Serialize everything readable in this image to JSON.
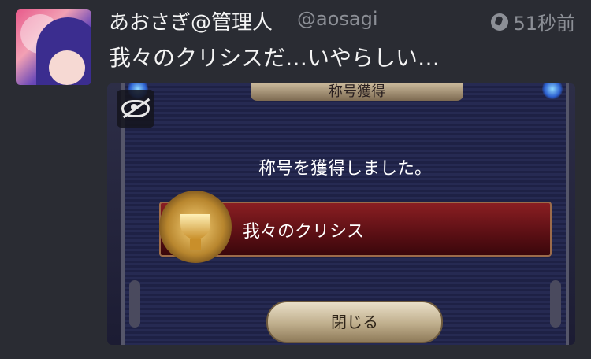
{
  "tweet": {
    "author_name": "あおさぎ@管理人",
    "handle": "@aosagi",
    "time": "51秒前",
    "text": "我々のクリシスだ…いやらしい…",
    "time_icon": "globe-icon",
    "avatar": "user-avatar"
  },
  "media": {
    "window_title": "称号獲得",
    "message": "称号を獲得しました。",
    "title_name": "我々のクリシス",
    "close_label": "閉じる",
    "sensitive_toggle_icon": "eye-slash-icon",
    "trophy_icon": "trophy-icon"
  },
  "colors": {
    "background": "#2a2c33",
    "text": "#f4f4f4",
    "muted": "#8c8f96"
  }
}
